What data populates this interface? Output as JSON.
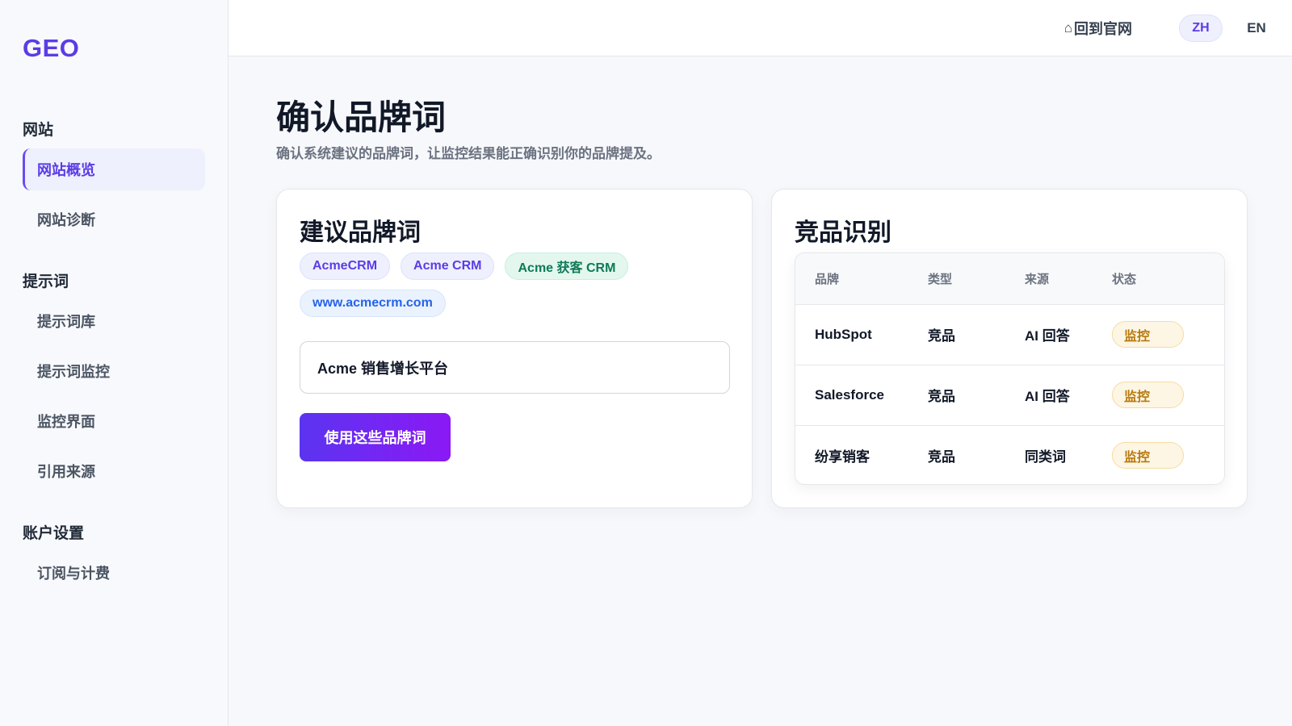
{
  "app": {
    "logo": "GEO"
  },
  "sidebar": {
    "sections": [
      {
        "title": "网站",
        "items": [
          {
            "label": "网站概览",
            "active": true
          },
          {
            "label": "网站诊断"
          }
        ]
      },
      {
        "title": "提示词",
        "items": [
          {
            "label": "提示词库"
          },
          {
            "label": "提示词监控"
          },
          {
            "label": "监控界面"
          },
          {
            "label": "引用来源"
          }
        ]
      },
      {
        "title": "账户设置",
        "items": [
          {
            "label": "订阅与计费"
          }
        ]
      }
    ]
  },
  "topbar": {
    "home_icon": "⌂",
    "home_label": "回到官网",
    "lang_zh": "ZH",
    "lang_en": "EN"
  },
  "page": {
    "title": "确认品牌词",
    "subtitle": "确认系统建议的品牌词，让监控结果能正确识别你的品牌提及。"
  },
  "suggest": {
    "title": "建议品牌词",
    "chips": [
      "AcmeCRM",
      "Acme CRM",
      "Acme 获客 CRM",
      "www.acmecrm.com"
    ],
    "input_value": "Acme 销售增长平台",
    "button_label": "使用这些品牌词"
  },
  "competitors": {
    "title": "竞品识别",
    "headers": [
      "品牌",
      "类型",
      "来源",
      "状态"
    ],
    "rows": [
      {
        "brand": "HubSpot",
        "type": "竞品",
        "source": "AI 回答",
        "status": "监控"
      },
      {
        "brand": "Salesforce",
        "type": "竞品",
        "source": "AI 回答",
        "status": "监控"
      },
      {
        "brand": "纷享销客",
        "type": "竞品",
        "source": "同类词",
        "status": "监控"
      }
    ]
  },
  "colors": {
    "accent": "#5b3ce6",
    "status": "#b7790e",
    "success": "#0f7a57",
    "link": "#2563eb"
  }
}
